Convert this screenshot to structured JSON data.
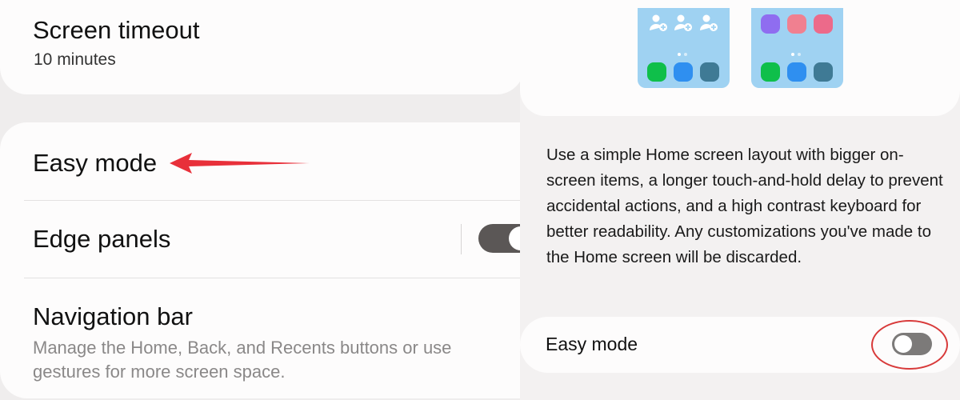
{
  "settings_list": {
    "screen_timeout": {
      "title": "Screen timeout",
      "value": "10 minutes"
    },
    "easy_mode": {
      "title": "Easy mode"
    },
    "edge_panels": {
      "title": "Edge panels",
      "toggle_state": "on"
    },
    "navigation_bar": {
      "title": "Navigation bar",
      "description": "Manage the Home, Back, and Recents buttons or use gestures for more screen space."
    }
  },
  "annotation": {
    "arrow_color": "#e8303a",
    "circle_color": "#d83a3a"
  },
  "easy_mode_screen": {
    "description": "Use a simple Home screen layout with bigger on-screen items, a longer touch-and-hold delay to prevent accidental actions, and a high contrast keyboard for better readability. Any customizations you've made to the Home screen will be discarded.",
    "setting_label": "Easy mode",
    "toggle_state": "off"
  },
  "colors": {
    "preview_bg": "#9fd2f2",
    "green": "#0fbf4a",
    "blue": "#2f8ff0",
    "teal": "#3f7a95",
    "purple": "#8f6df0",
    "pink": "#f08090",
    "rose": "#ec6a8a"
  }
}
